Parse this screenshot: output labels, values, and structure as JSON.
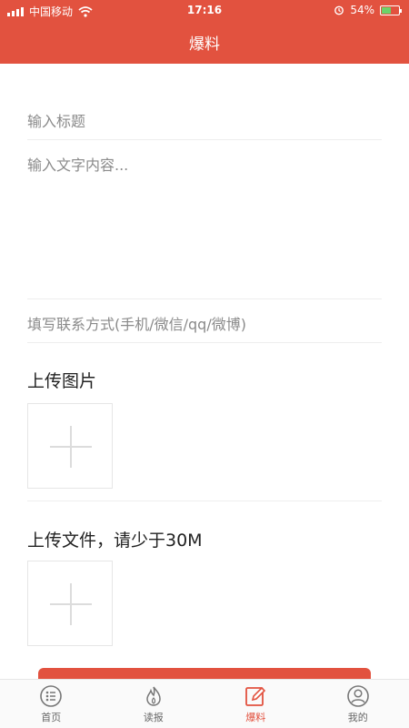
{
  "status_bar": {
    "carrier": "中国移动",
    "time": "17:16",
    "battery": "54%",
    "battery_level": 0.54
  },
  "header": {
    "title": "爆料"
  },
  "form": {
    "title_placeholder": "输入标题",
    "content_placeholder": "输入文字内容...",
    "contact_placeholder": "填写联系方式(手机/微信/qq/微博)"
  },
  "upload_image": {
    "label": "上传图片"
  },
  "upload_file": {
    "label": "上传文件，请少于30M"
  },
  "tabs": [
    {
      "label": "首页",
      "icon": "home-icon"
    },
    {
      "label": "读报",
      "icon": "flame-icon"
    },
    {
      "label": "爆料",
      "icon": "edit-icon",
      "active": true
    },
    {
      "label": "我的",
      "icon": "user-icon"
    }
  ],
  "colors": {
    "primary": "#e2523f"
  }
}
